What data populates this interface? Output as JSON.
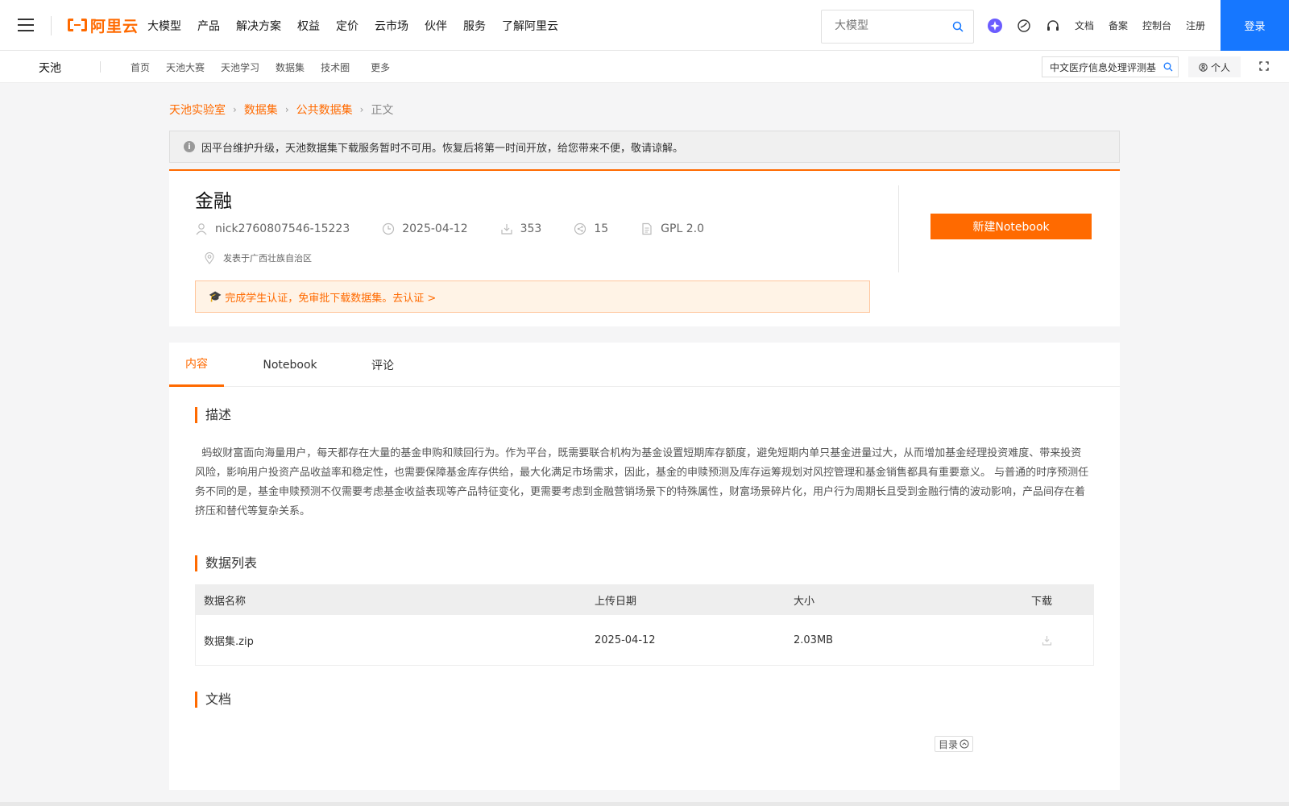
{
  "topnav": {
    "logo_text": "阿里云",
    "menu": [
      "大模型",
      "产品",
      "解决方案",
      "权益",
      "定价",
      "云市场",
      "伙伴",
      "服务",
      "了解阿里云"
    ],
    "search_placeholder": "大模型",
    "links": [
      "文档",
      "备案",
      "控制台",
      "注册"
    ],
    "login": "登录"
  },
  "subnav": {
    "brand": "天池",
    "menu": [
      "首页",
      "天池大赛",
      "天池学习",
      "数据集",
      "技术圈",
      "更多"
    ],
    "search_value": "中文医疗信息处理评测基",
    "personal": "个人"
  },
  "breadcrumb": [
    "天池实验室",
    "数据集",
    "公共数据集",
    "正文"
  ],
  "notice": "因平台维护升级，天池数据集下载服务暂时不可用。恢复后将第一时间开放，给您带来不便，敬请谅解。",
  "dataset": {
    "title": "金融",
    "author": "nick2760807546-15223",
    "date": "2025-04-12",
    "downloads": "353",
    "shares": "15",
    "license": "GPL 2.0",
    "location": "发表于广西壮族自治区",
    "student_notice": "完成学生认证，免审批下载数据集。去认证 >",
    "new_notebook": "新建Notebook"
  },
  "tabs": [
    "内容",
    "Notebook",
    "评论"
  ],
  "sections": {
    "description_title": "描述",
    "description": "  蚂蚁财富面向海量用户，每天都存在大量的基金申购和赎回行为。作为平台，既需要联合机构为基金设置短期库存额度，避免短期内单只基金进量过大，从而增加基金经理投资难度、带来投资风险，影响用户投资产品收益率和稳定性，也需要保障基金库存供给，最大化满足市场需求，因此，基金的申赎预测及库存运筹规划对风控管理和基金销售都具有重要意义。 与普通的时序预测任务不同的是，基金申赎预测不仅需要考虑基金收益表现等产品特征变化，更需要考虑到金融营销场景下的特殊属性，财富场景碎片化，用户行为周期长且受到金融行情的波动影响，产品间存在着挤压和替代等复杂关系。",
    "datalist_title": "数据列表",
    "docs_title": "文档"
  },
  "table": {
    "headers": [
      "数据名称",
      "上传日期",
      "大小",
      "下载"
    ],
    "rows": [
      {
        "name": "数据集.zip",
        "date": "2025-04-12",
        "size": "2.03MB"
      }
    ]
  },
  "toc": "目录",
  "colors": {
    "accent": "#ff6a00",
    "login": "#1677ff"
  }
}
